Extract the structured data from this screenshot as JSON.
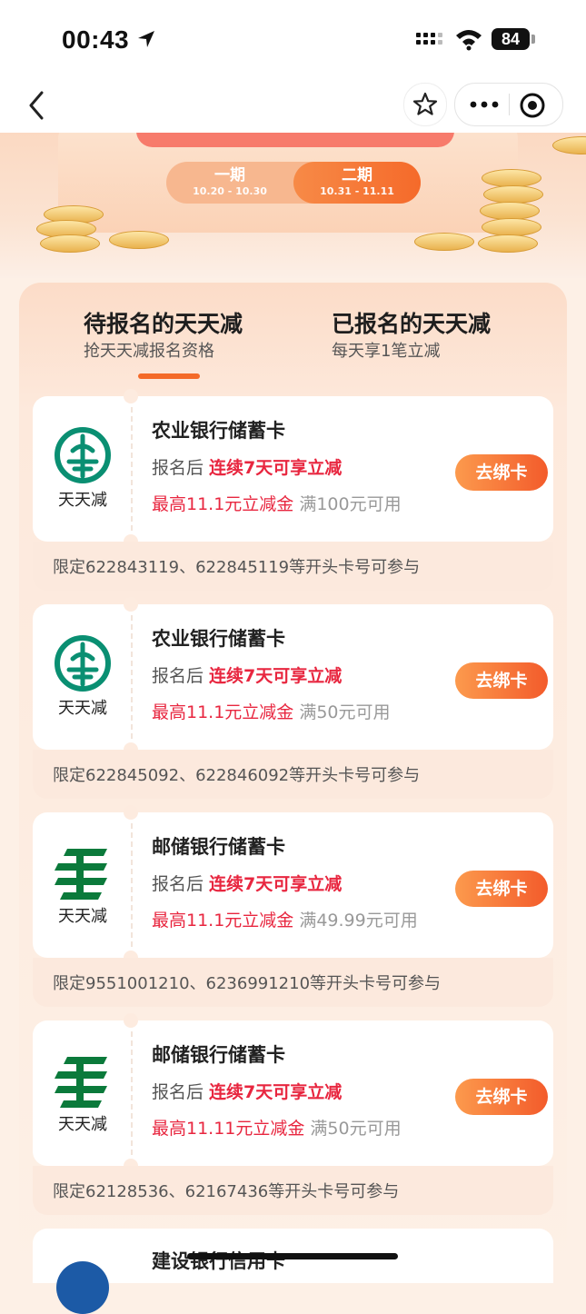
{
  "status_bar": {
    "time": "00:43",
    "battery": "84"
  },
  "banner": {
    "phases": [
      {
        "name": "一期",
        "date": "10.20 - 10.30",
        "active": false
      },
      {
        "name": "二期",
        "date": "10.31 - 11.11",
        "active": true
      }
    ]
  },
  "tabs": [
    {
      "title": "待报名的天天减",
      "subtitle": "抢天天减报名资格",
      "active": true
    },
    {
      "title": "已报名的天天减",
      "subtitle": "每天享1笔立减",
      "active": false
    }
  ],
  "cards": [
    {
      "logo": "abc-bank-icon",
      "logo_caption": "天天减",
      "bank": "农业银行储蓄卡",
      "after_signup": "报名后",
      "promo": "连续7天可享立减",
      "max": "最高11.1元立减金",
      "threshold": "满100元可用",
      "button": "去绑卡",
      "limit": "限定622843119、622845119等开头卡号可参与"
    },
    {
      "logo": "abc-bank-icon",
      "logo_caption": "天天减",
      "bank": "农业银行储蓄卡",
      "after_signup": "报名后",
      "promo": "连续7天可享立减",
      "max": "最高11.1元立减金",
      "threshold": "满50元可用",
      "button": "去绑卡",
      "limit": "限定622845092、622846092等开头卡号可参与"
    },
    {
      "logo": "psbc-bank-icon",
      "logo_caption": "天天减",
      "bank": "邮储银行储蓄卡",
      "after_signup": "报名后",
      "promo": "连续7天可享立减",
      "max": "最高11.1元立减金",
      "threshold": "满49.99元可用",
      "button": "去绑卡",
      "limit": "限定9551001210、6236991210等开头卡号可参与"
    },
    {
      "logo": "psbc-bank-icon",
      "logo_caption": "天天减",
      "bank": "邮储银行储蓄卡",
      "after_signup": "报名后",
      "promo": "连续7天可享立减",
      "max": "最高11.11元立减金",
      "threshold": "满50元可用",
      "button": "去绑卡",
      "limit": "限定62128536、62167436等开头卡号可参与"
    }
  ],
  "partial_card": {
    "logo": "ccb-bank-icon",
    "bank": "建设银行信用卡"
  },
  "colors": {
    "accent": "#f46a28",
    "promo_red": "#e8263f",
    "abc_green": "#0a8f72",
    "psbc_green": "#0b7a3b"
  }
}
